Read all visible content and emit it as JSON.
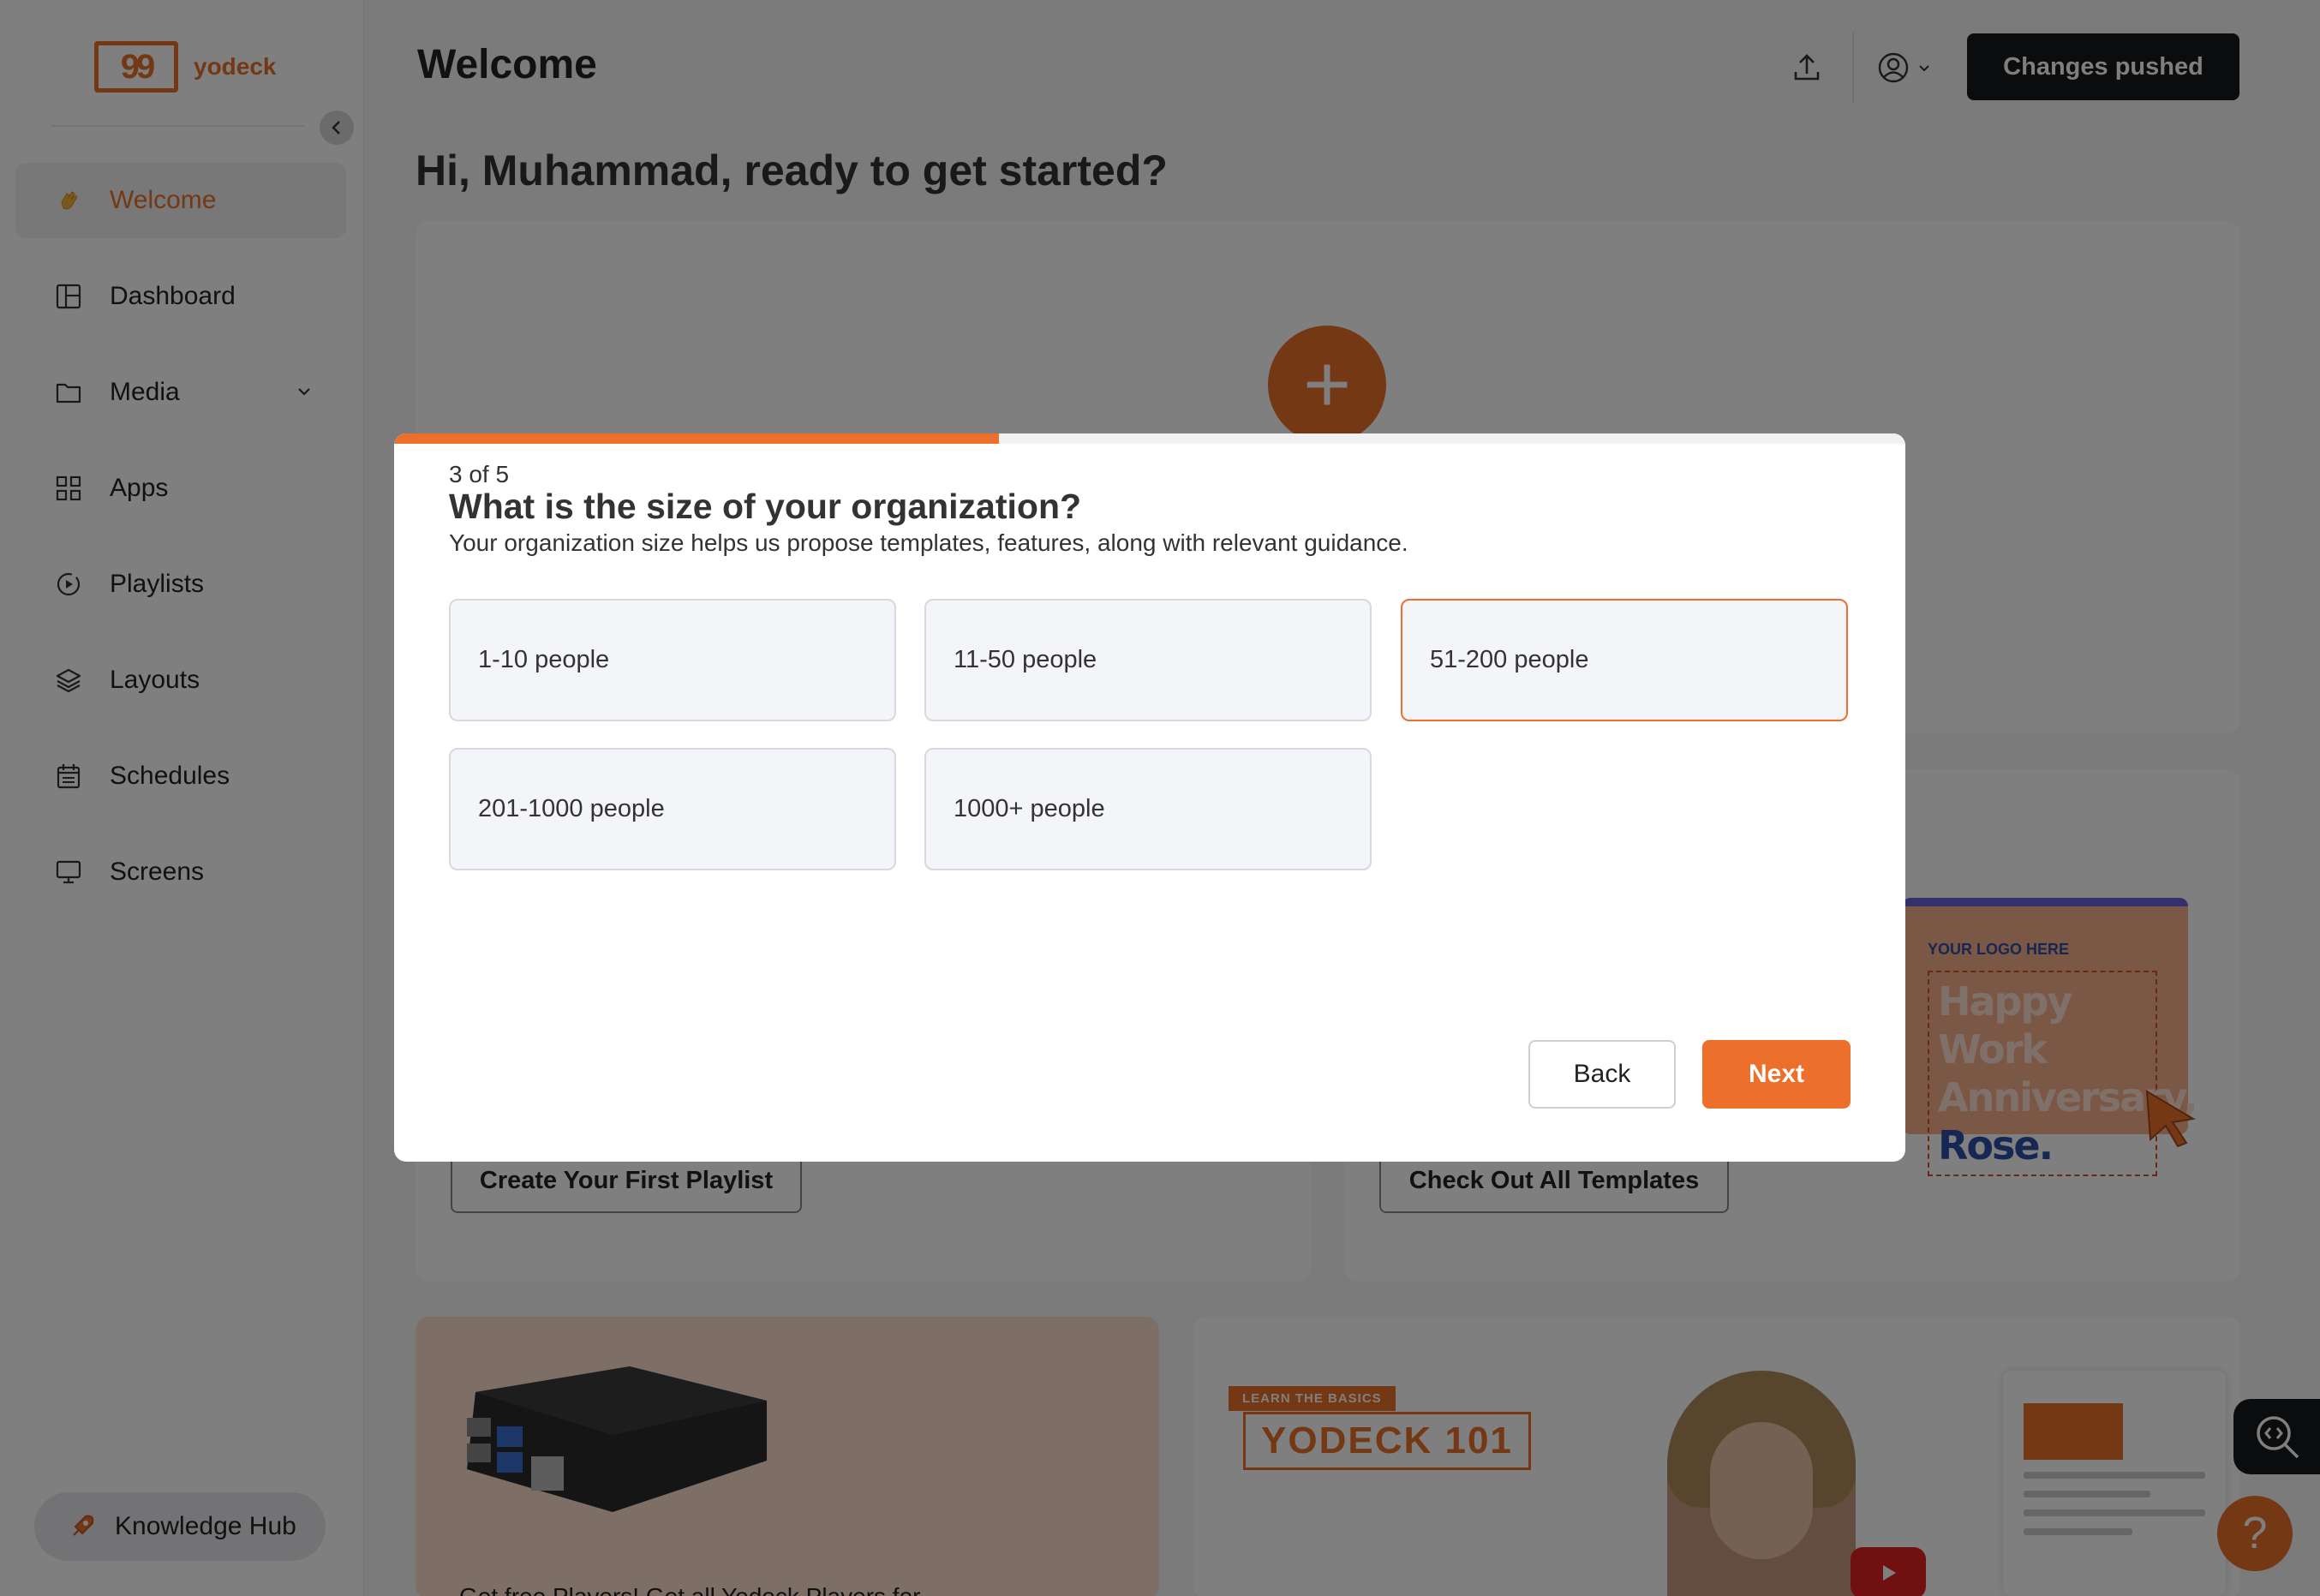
{
  "app": {
    "logo_text": "yodeck",
    "logo_mark": "99"
  },
  "header": {
    "title": "Welcome",
    "pushed_label": "Changes pushed"
  },
  "sidebar": {
    "items": [
      {
        "label": "Welcome",
        "icon": "waving-hand-icon",
        "active": true
      },
      {
        "label": "Dashboard",
        "icon": "dashboard-icon"
      },
      {
        "label": "Media",
        "icon": "folder-icon",
        "has_chevron": true
      },
      {
        "label": "Apps",
        "icon": "apps-grid-icon"
      },
      {
        "label": "Playlists",
        "icon": "playlist-icon"
      },
      {
        "label": "Layouts",
        "icon": "layers-icon"
      },
      {
        "label": "Schedules",
        "icon": "calendar-icon"
      },
      {
        "label": "Screens",
        "icon": "monitor-icon"
      }
    ],
    "knowledge_hub": "Knowledge Hub"
  },
  "main": {
    "greeting": "Hi, Muhammad, ready to get started?",
    "playlist_button": "Create Your First Playlist",
    "templates_button": "Check Out All Templates",
    "template_preview": {
      "logo": "YOUR LOGO HERE",
      "line1": "Happy Work",
      "line2": "Anniversary,",
      "line3": "Rose."
    },
    "promo_text": "Get free Players! Get all Yodeck Players for",
    "learn_tag": "LEARN THE BASICS",
    "video_title": "YODECK 101"
  },
  "modal": {
    "progress_fraction": 0.4,
    "step": "3 of 5",
    "title": "What is the size of your organization?",
    "subtitle": "Your organization size helps us propose templates, features, along with relevant guidance.",
    "options": [
      {
        "label": "1-10 people"
      },
      {
        "label": "11-50 people"
      },
      {
        "label": "51-200 people",
        "selected": true
      },
      {
        "label": "201-1000 people"
      },
      {
        "label": "1000+ people"
      }
    ],
    "back_label": "Back",
    "next_label": "Next"
  },
  "colors": {
    "accent": "#ec6f2c",
    "dark": "#17181c",
    "overlay": "rgba(0,0,0,0.5)"
  }
}
